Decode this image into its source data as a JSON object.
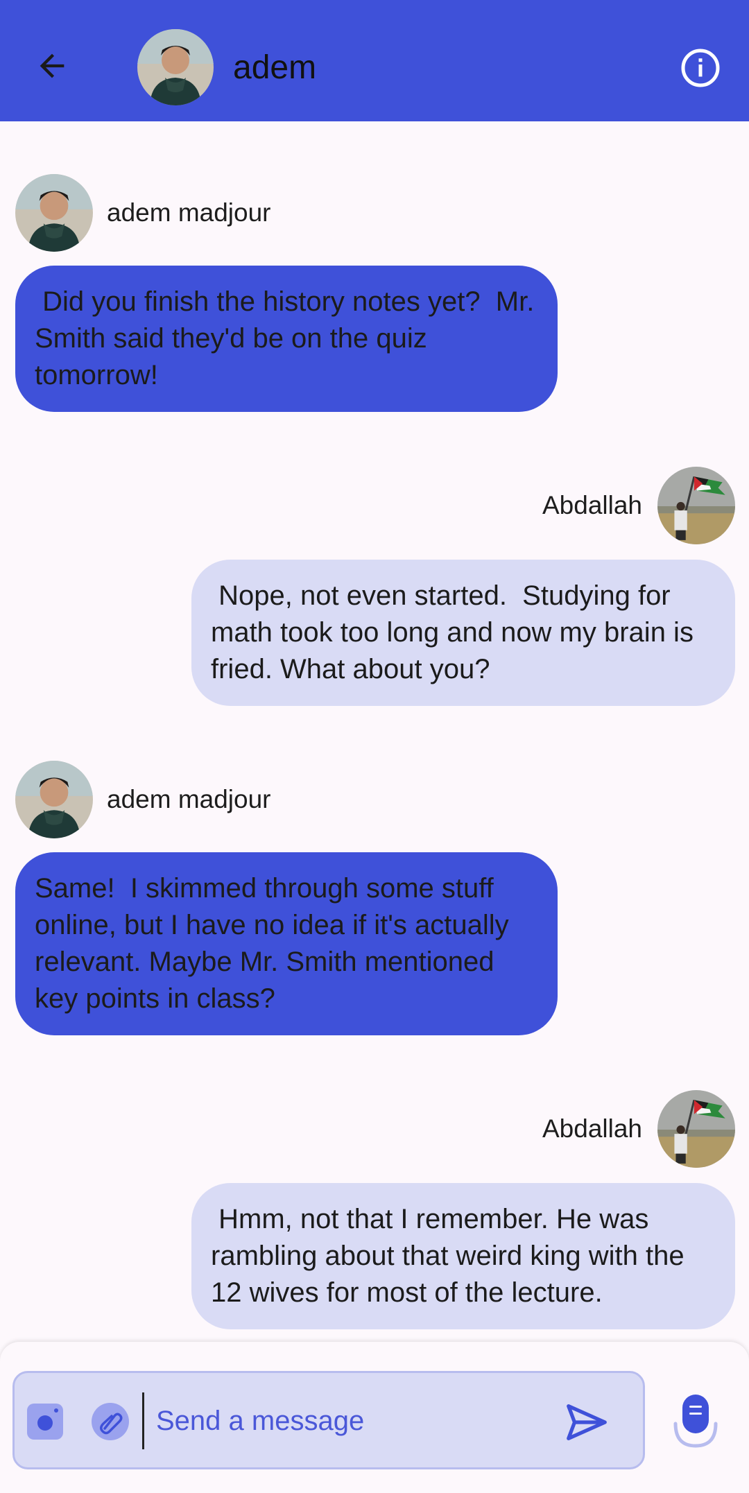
{
  "header": {
    "title": "adem",
    "back_icon": "arrow-left-icon",
    "info_icon": "info-circle-icon",
    "background": "#3f51d9"
  },
  "messages": [
    {
      "sender": "adem madjour",
      "side": "incoming",
      "text": " Did you finish the history notes yet?  Mr. Smith said they'd be on the quiz tomorrow!"
    },
    {
      "sender": "Abdallah",
      "side": "outgoing",
      "text": " Nope, not even started.  Studying for math took too long and now my brain is fried. What about you?"
    },
    {
      "sender": "adem madjour",
      "side": "incoming",
      "text": "Same!  I skimmed through some stuff online, but I have no idea if it's actually relevant. Maybe Mr. Smith mentioned key points in class?"
    },
    {
      "sender": "Abdallah",
      "side": "outgoing",
      "text": " Hmm, not that I remember. He was rambling about that weird king with the 12 wives for most of the lecture."
    }
  ],
  "composer": {
    "placeholder": "Send a message",
    "camera_icon": "camera-icon",
    "attach_icon": "attachment-icon",
    "send_icon": "send-icon",
    "mic_icon": "microphone-icon"
  },
  "colors": {
    "accent": "#3f51d9",
    "outgoing_bubble": "#d9dbf5",
    "background": "#fdf8fc"
  }
}
